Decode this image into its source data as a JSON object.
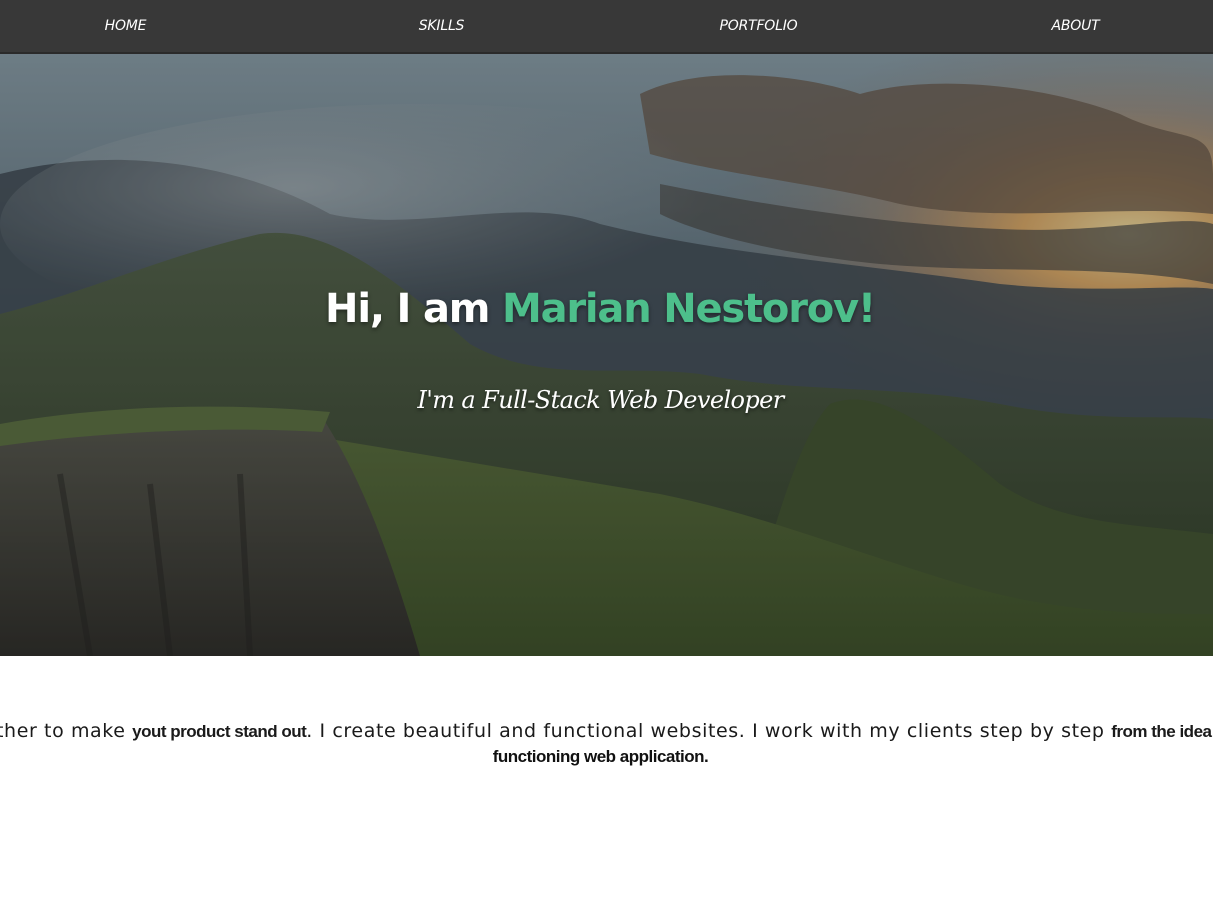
{
  "nav": {
    "items": [
      {
        "label": "HOME"
      },
      {
        "label": "SKILLS"
      },
      {
        "label": "PORTFOLIO"
      },
      {
        "label": "ABOUT"
      }
    ]
  },
  "hero": {
    "greeting": "Hi, I am ",
    "name": "Marian Nestorov!",
    "subtitle": "I'm a Full-Stack Web Developer",
    "accent_color": "#4dbf8b"
  },
  "intro": {
    "part1": "ther to make ",
    "strong1": "yout product stand out",
    "part2": ". I create beautiful and functional websites. I work with my clients step by step ",
    "strong2": "from the idea sta",
    "line2": "functioning web application."
  },
  "colors": {
    "navbar": "#383838",
    "text": "#1a1a1a",
    "white": "#ffffff"
  }
}
